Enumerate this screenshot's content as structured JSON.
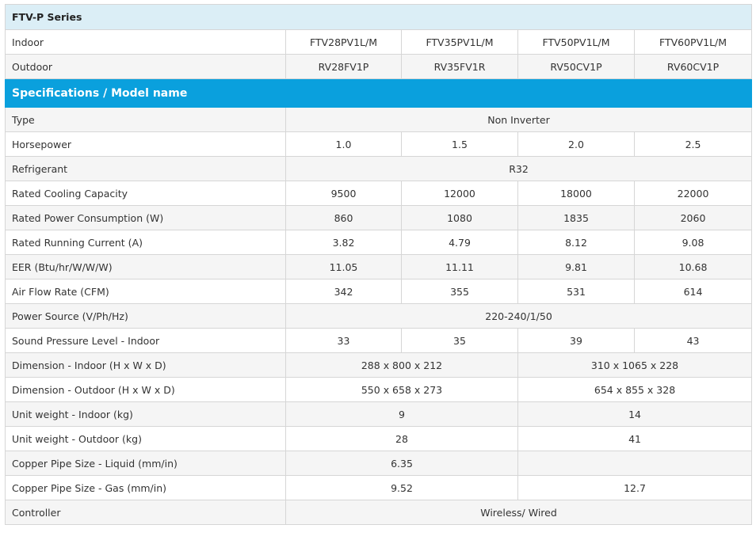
{
  "series_title": "FTV-P Series",
  "indoor": {
    "label": "Indoor",
    "models": [
      "FTV28PV1L/M",
      "FTV35PV1L/M",
      "FTV50PV1L/M",
      "FTV60PV1L/M"
    ]
  },
  "outdoor": {
    "label": "Outdoor",
    "models": [
      "RV28FV1P",
      "RV35FV1R",
      "RV50CV1P",
      "RV60CV1P"
    ]
  },
  "section_title": "Specifications / Model name",
  "specs": {
    "type": {
      "label": "Type",
      "value": "Non Inverter"
    },
    "horsepower": {
      "label": "Horsepower",
      "values": [
        "1.0",
        "1.5",
        "2.0",
        "2.5"
      ]
    },
    "refrigerant": {
      "label": "Refrigerant",
      "value": "R32"
    },
    "cooling_capacity": {
      "label": "Rated Cooling Capacity",
      "values": [
        "9500",
        "12000",
        "18000",
        "22000"
      ]
    },
    "power_consumption": {
      "label": "Rated Power Consumption (W)",
      "values": [
        "860",
        "1080",
        "1835",
        "2060"
      ]
    },
    "running_current": {
      "label": "Rated Running Current (A)",
      "values": [
        "3.82",
        "4.79",
        "8.12",
        "9.08"
      ]
    },
    "eer": {
      "label": "EER (Btu/hr/W/W/W)",
      "values": [
        "11.05",
        "11.11",
        "9.81",
        "10.68"
      ]
    },
    "air_flow": {
      "label": "Air Flow Rate (CFM)",
      "values": [
        "342",
        "355",
        "531",
        "614"
      ]
    },
    "power_source": {
      "label": "Power Source (V/Ph/Hz)",
      "value": "220-240/1/50"
    },
    "sound_pressure": {
      "label": "Sound Pressure Level - Indoor",
      "values": [
        "33",
        "35",
        "39",
        "43"
      ]
    },
    "dimension_indoor": {
      "label": "Dimension - Indoor (H x W x D)",
      "values": [
        "288 x 800 x 212",
        "310 x 1065 x 228"
      ]
    },
    "dimension_outdoor": {
      "label": "Dimension - Outdoor (H x W x D)",
      "values": [
        "550 x 658 x 273",
        "654 x 855 x 328"
      ]
    },
    "weight_indoor": {
      "label": "Unit weight - Indoor (kg)",
      "values": [
        "9",
        "14"
      ]
    },
    "weight_outdoor": {
      "label": "Unit weight - Outdoor (kg)",
      "values": [
        "28",
        "41"
      ]
    },
    "pipe_liquid": {
      "label": "Copper Pipe Size - Liquid (mm/in)",
      "values": [
        "6.35",
        ""
      ]
    },
    "pipe_gas": {
      "label": "Copper Pipe Size - Gas (mm/in)",
      "values": [
        "9.52",
        "12.7"
      ]
    },
    "controller": {
      "label": "Controller",
      "value": "Wireless/ Wired"
    }
  }
}
